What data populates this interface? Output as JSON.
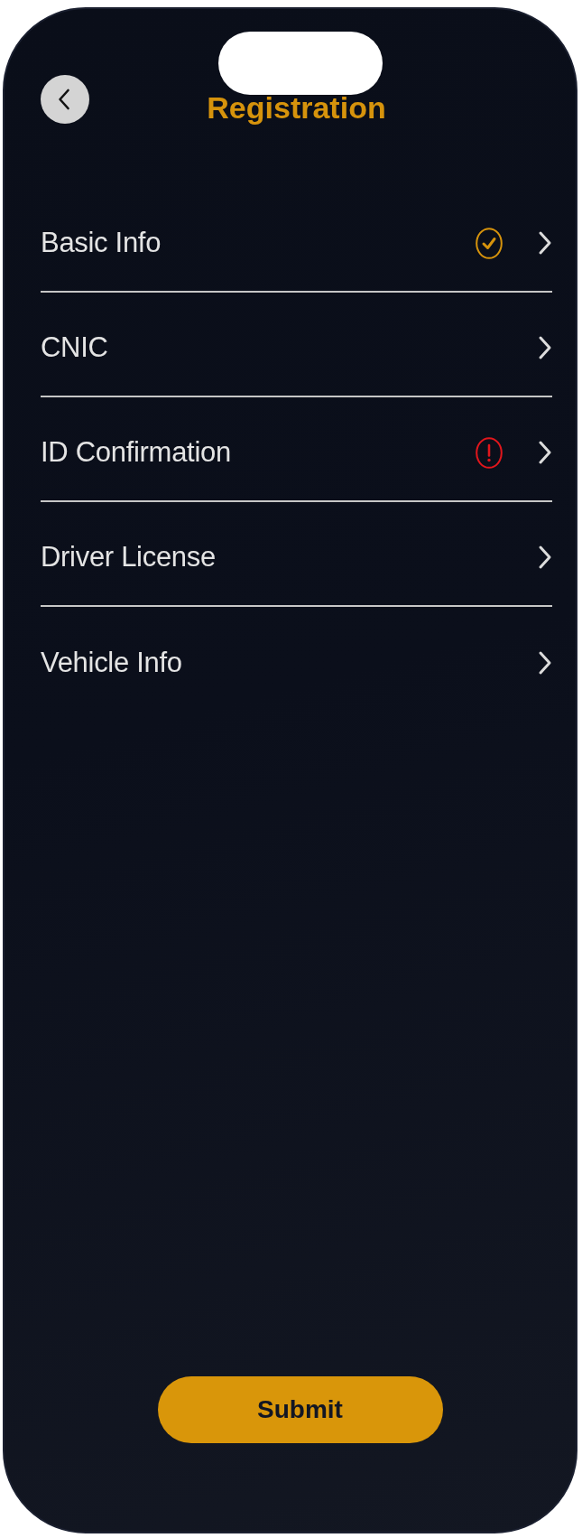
{
  "header": {
    "title": "Registration"
  },
  "items": [
    {
      "label": "Basic Info",
      "complete": true,
      "error": false
    },
    {
      "label": "CNIC",
      "complete": false,
      "error": false
    },
    {
      "label": "ID Confirmation",
      "complete": false,
      "error": true
    },
    {
      "label": "Driver License",
      "complete": false,
      "error": false
    },
    {
      "label": "Vehicle Info",
      "complete": false,
      "error": false
    }
  ],
  "submit": {
    "label": "Submit"
  }
}
